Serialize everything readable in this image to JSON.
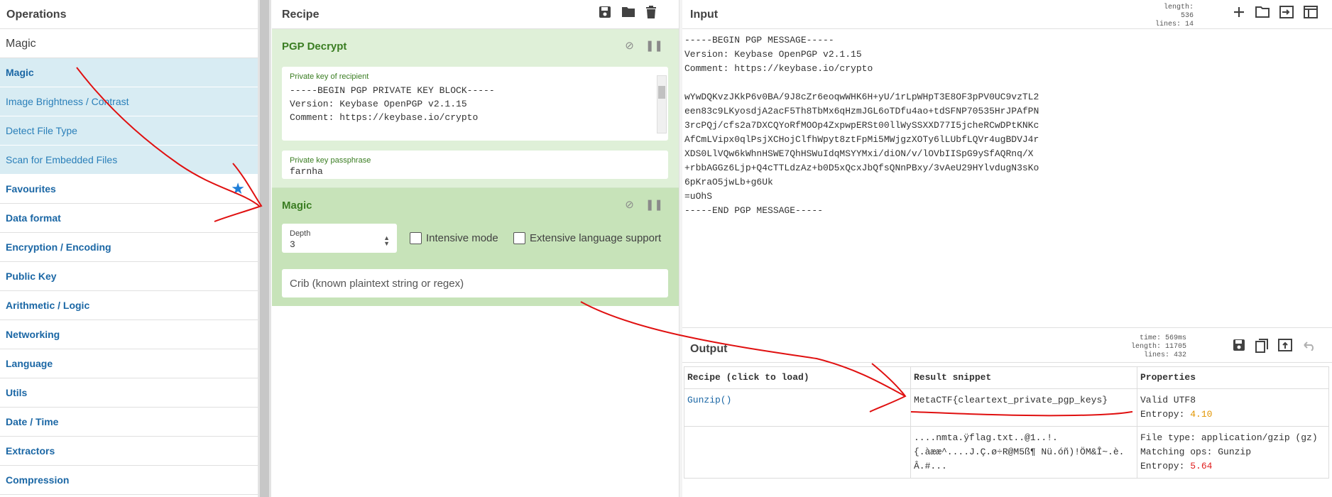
{
  "operations": {
    "title": "Operations",
    "search_value": "Magic",
    "results": [
      "Magic",
      "Image Brightness / Contrast",
      "Detect File Type",
      "Scan for Embedded Files"
    ],
    "categories": [
      "Favourites",
      "Data format",
      "Encryption / Encoding",
      "Public Key",
      "Arithmetic / Logic",
      "Networking",
      "Language",
      "Utils",
      "Date / Time",
      "Extractors",
      "Compression"
    ]
  },
  "recipe": {
    "title": "Recipe",
    "pgp": {
      "title": "PGP Decrypt",
      "key_label": "Private key of recipient",
      "key_value": "-----BEGIN PGP PRIVATE KEY BLOCK-----\nVersion: Keybase OpenPGP v2.1.15\nComment: https://keybase.io/crypto",
      "pass_label": "Private key passphrase",
      "pass_value": "farnha"
    },
    "magic": {
      "title": "Magic",
      "depth_label": "Depth",
      "depth_value": "3",
      "intensive_label": "Intensive mode",
      "extensive_label": "Extensive language support",
      "crib_placeholder": "Crib (known plaintext string or regex)"
    }
  },
  "input": {
    "title": "Input",
    "length_label": "length:",
    "length_value": "536",
    "lines_label": "lines:",
    "lines_value": "14",
    "text": "-----BEGIN PGP MESSAGE-----\nVersion: Keybase OpenPGP v2.1.15\nComment: https://keybase.io/crypto\n\nwYwDQKvzJKkP6v0BA/9J8cZr6eoqwWHK6H+yU/1rLpWHpT3E8OF3pPV0UC9vzTL2\neen83c9LKyosdjA2acF5Th8TbMx6qHzmJGL6oTDfu4ao+tdSFNP70535HrJPAfPN\n3rcPQj/cfs2a7DXCQYoRfMOOp4ZxpwpERSt00llWySSXXD77I5jcheRCwDPtKNKc\nAfCmLVipx0qlPsjXCHojClfhWpyt8ztFpMi5MWjgzXOTy6lLUbfLQVr4ugBDVJ4r\nXDS0LlVQw6kWhnHSWE7QhHSWuIdqMSYYMxi/diON/v/lOVbIISpG9ySfAQRnq/X\n+rbbAGGz6Ljp+Q4cTTLdzAz+b0D5xQcxJbQfsQNnPBxy/3vAeU29HYlvdugN3sKo\n6pKraO5jwLb+g6Uk\n=uOhS\n-----END PGP MESSAGE-----"
  },
  "output": {
    "title": "Output",
    "time_label": "time:",
    "time_value": "569ms",
    "length_label": "length:",
    "length_value": "11705",
    "lines_label": "lines:",
    "lines_value": "432",
    "headers": [
      "Recipe (click to load)",
      "Result snippet",
      "Properties"
    ],
    "row1": {
      "recipe": "Gunzip()",
      "snippet": "MetaCTF{cleartext_private_pgp_keys}",
      "prop1": "Valid UTF8",
      "entropy_label": "Entropy: ",
      "entropy_value": "4.10"
    },
    "row2": {
      "snippet": "....nmta.ÿflag.txt..@1..!.\n{.àææ^....J.Ç.ø÷R@M5ß¶ Nü.óñ)!ÖM&Î~.è.\nÂ.#...",
      "prop1": "File type: application/gzip (gz)",
      "prop2": "Matching ops: Gunzip",
      "entropy_label": "Entropy: ",
      "entropy_value": "5.64"
    }
  },
  "colors": {
    "accent_blue": "#1b67a5",
    "pgp_bg": "#dff0d8",
    "magic_bg": "#c7e3b9",
    "annotation_red": "#e01010"
  },
  "icons": [
    "save-icon",
    "folder-icon",
    "trash-icon",
    "disable-icon",
    "pause-icon",
    "plus-icon",
    "open-folder-icon",
    "import-icon",
    "columns-icon",
    "copy-icon",
    "replace-input-icon",
    "undo-icon",
    "star-icon"
  ]
}
